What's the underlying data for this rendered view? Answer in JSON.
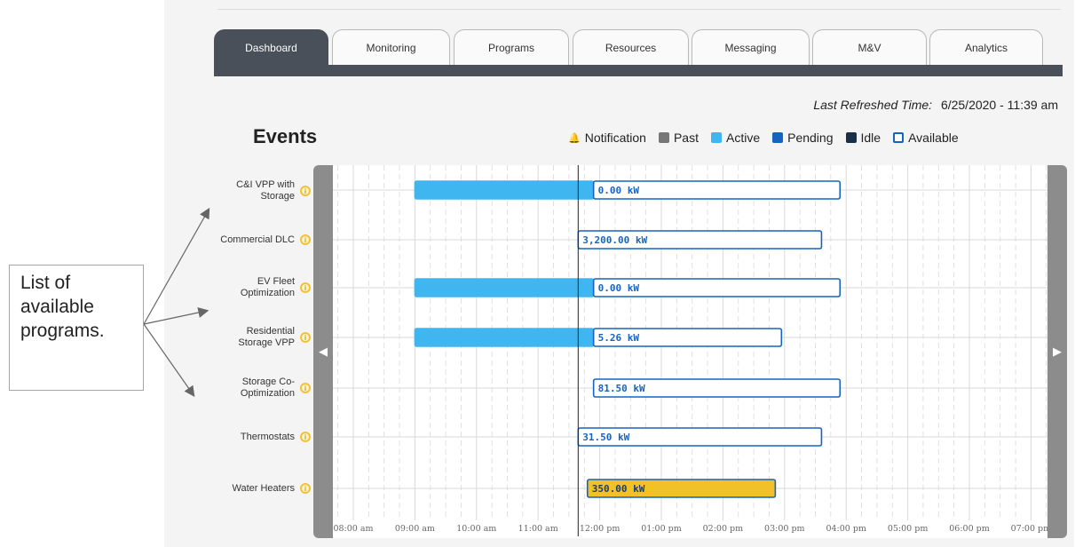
{
  "tabs": [
    {
      "label": "Dashboard",
      "active": true
    },
    {
      "label": "Monitoring",
      "active": false
    },
    {
      "label": "Programs",
      "active": false
    },
    {
      "label": "Resources",
      "active": false
    },
    {
      "label": "Messaging",
      "active": false
    },
    {
      "label": "M&V",
      "active": false
    },
    {
      "label": "Analytics",
      "active": false
    }
  ],
  "refresh": {
    "label": "Last Refreshed Time:",
    "value": "6/25/2020 - 11:39 am"
  },
  "events_title": "Events",
  "legend": [
    {
      "label": "Notification",
      "icon": "bell-icon"
    },
    {
      "label": "Past",
      "color": "#777777",
      "style": "filled"
    },
    {
      "label": "Active",
      "color": "#3fb6ef",
      "style": "filled"
    },
    {
      "label": "Pending",
      "color": "#1565c0",
      "style": "filled"
    },
    {
      "label": "Idle",
      "color": "#1c2f48",
      "style": "filled"
    },
    {
      "label": "Available",
      "color": "#1565c0",
      "style": "outline"
    }
  ],
  "note": "List of available programs.",
  "chart_data": {
    "type": "gantt",
    "x_axis": {
      "tick_labels": [
        "08:00 am",
        "09:00 am",
        "10:00 am",
        "11:00 am",
        "12:00 pm",
        "01:00 pm",
        "02:00 pm",
        "03:00 pm",
        "04:00 pm",
        "05:00 pm",
        "06:00 pm",
        "07:00 pm"
      ],
      "range_hours": [
        8.0,
        20.0
      ]
    },
    "current_time": 11.65,
    "colors": {
      "active": "#3fb6ef",
      "available": "#1565c0",
      "pending_fill": "#f2c027",
      "grid": "#d9d9d9"
    },
    "programs": [
      {
        "label": "C&I VPP with Storage",
        "bars": [
          {
            "status": "Active",
            "start": 9.0,
            "end": 11.9
          },
          {
            "status": "Available",
            "start": 11.9,
            "end": 15.9,
            "value": "0.00 kW"
          }
        ]
      },
      {
        "label": "Commercial DLC",
        "bars": [
          {
            "status": "Available",
            "start": 11.65,
            "end": 15.6,
            "value": "3,200.00 kW"
          }
        ]
      },
      {
        "label": "EV Fleet Optimization",
        "bars": [
          {
            "status": "Active",
            "start": 9.0,
            "end": 11.9
          },
          {
            "status": "Available",
            "start": 11.9,
            "end": 15.9,
            "value": "0.00 kW"
          }
        ]
      },
      {
        "label": "Residential Storage VPP",
        "bars": [
          {
            "status": "Active",
            "start": 9.0,
            "end": 11.9
          },
          {
            "status": "Available",
            "start": 11.9,
            "end": 14.95,
            "value": "5.26 kW"
          }
        ]
      },
      {
        "label": "Storage Co-Optimization",
        "bars": [
          {
            "status": "Available",
            "start": 11.9,
            "end": 15.9,
            "value": "81.50 kW"
          }
        ]
      },
      {
        "label": "Thermostats",
        "bars": [
          {
            "status": "Available",
            "start": 11.65,
            "end": 15.6,
            "value": "31.50 kW"
          }
        ]
      },
      {
        "label": "Water Heaters",
        "bars": [
          {
            "status": "Pending",
            "start": 11.8,
            "end": 14.85,
            "value": "350.00 kW"
          }
        ]
      }
    ]
  }
}
